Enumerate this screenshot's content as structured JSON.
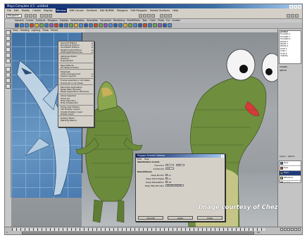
{
  "window": {
    "title": "Maya Complete 4.5 - untitled"
  },
  "menubar": {
    "items": [
      "File",
      "Edit",
      "Modify",
      "Create",
      "Display",
      "Window",
      "Edit Curves",
      "Surfaces",
      "Edit NURBS",
      "Polygons",
      "Edit Polygons",
      "Subdiv Surfaces",
      "Help"
    ],
    "selected_index": 5
  },
  "statusline": {
    "mode": "Polygons"
  },
  "shelf": {
    "tabs": [
      "General",
      "Curves",
      "Surfaces",
      "Polygons",
      "Subdivs",
      "Deformation",
      "Animation",
      "Dynamics",
      "Rendering",
      "PaintEffects",
      "Toon",
      "Cloth",
      "Fluids",
      "Fur",
      "Custom"
    ],
    "icon_colors": [
      "#2f5fb0",
      "#3a7dc9",
      "#4b8bd6",
      "#d04a2a",
      "#d8b23a",
      "#6aa84f",
      "#3a7dc9",
      "#8e5cc0",
      "#d04a2a",
      "#2f5fb0",
      "#3a7dc9",
      "#6aa84f",
      "#d8b23a",
      "#4b8bd6",
      "#2f5fb0",
      "#3a7dc9",
      "#d04a2a",
      "#6aa84f",
      "#8e5cc0",
      "#4b8bd6",
      "#2f5fb0",
      "#3a7dc9",
      "#d8b23a",
      "#6aa84f",
      "#4b8bd6",
      "#2f5fb0",
      "#d04a2a",
      "#3a7dc9",
      "#6aa84f",
      "#8e5cc0",
      "#2f5fb0",
      "#4b8bd6"
    ]
  },
  "panel_menu": [
    "View",
    "Shading",
    "Lighting",
    "Show",
    "Panels"
  ],
  "window_menu": {
    "items": [
      {
        "label": "General Editors",
        "sub": true
      },
      {
        "label": "Rendering Editors",
        "sub": true
      },
      {
        "label": "Animation Editors",
        "sub": true
      },
      {
        "label": "Relationship Editors",
        "sub": true
      },
      {
        "label": "Settings/Preferences",
        "sub": true
      },
      {
        "label": "",
        "sep": true
      },
      {
        "label": "Attribute Editor"
      },
      {
        "label": "Outliner"
      },
      {
        "label": "Hypergraph"
      },
      {
        "label": "",
        "sep": true
      },
      {
        "label": "Paint Effects"
      },
      {
        "label": "UV Texture Editor"
      },
      {
        "label": "",
        "sep": true
      },
      {
        "label": "Playblast"
      },
      {
        "label": "View Arrangement",
        "sub": true
      },
      {
        "label": "Saved Layouts",
        "sub": true
      },
      {
        "label": "",
        "sep": true
      },
      {
        "label": "Frame Selected in All Views"
      },
      {
        "label": "Frame All in All Views"
      },
      {
        "label": "",
        "sep": true
      },
      {
        "label": "Minimize Application"
      },
      {
        "label": "Raise Main Window"
      },
      {
        "label": "Raise Application Windows"
      },
      {
        "label": "",
        "sep": true
      },
      {
        "label": "Show Selected"
      },
      {
        "label": "Show All"
      },
      {
        "label": "Hide Selection"
      },
      {
        "label": "Hide Unselected"
      },
      {
        "label": "",
        "sep": true
      },
      {
        "label": "Show Last Hidden"
      },
      {
        "label": "Set Display Layers"
      },
      {
        "label": "Create Display Layer"
      },
      {
        "label": "Delete Layer"
      },
      {
        "label": "",
        "sep": true
      },
      {
        "label": "Hotkey Editor"
      },
      {
        "label": "Marking Menus"
      }
    ]
  },
  "dialog": {
    "title": "Polygon Smooth Options",
    "menu": [
      "Edit",
      "Help"
    ],
    "section1": "Subdivision Levels",
    "rows1": [
      {
        "label": "Divisions",
        "values": [
          "1",
          "1.0"
        ]
      },
      {
        "label": "Continuity",
        "values": [
          "1.0"
        ]
      }
    ],
    "section2": "Smoothness",
    "rows2": [
      {
        "label": "Keep Border",
        "values": [
          "on"
        ]
      },
      {
        "label": "Keep Hard Edges",
        "values": [
          "on"
        ]
      },
      {
        "label": "Keep Tessellation",
        "values": [
          "off"
        ]
      },
      {
        "label": "Keep Map Borders",
        "values": [
          "Smooth Internal"
        ]
      }
    ],
    "buttons": [
      "Smooth",
      "Apply",
      "Close"
    ]
  },
  "watermark": "Image courtesy of Chez Eddy",
  "channel_box": {
    "object": "pCube1",
    "attrs": [
      "Translate X",
      "Translate Y",
      "Translate Z",
      "Rotate X",
      "Rotate Y",
      "Rotate Z",
      "Scale X",
      "Scale Y",
      "Scale Z",
      "Visibility"
    ],
    "shapes_label": "SHAPES",
    "inputs_label": "INPUTS"
  },
  "layer_editor": {
    "tabs": [
      "Layers",
      "Options"
    ],
    "layers": [
      {
        "name": "Body",
        "color": "#3a7dc9",
        "selected": false
      },
      {
        "name": "Eyes",
        "color": "#d04a2a",
        "selected": false
      },
      {
        "name": "Head",
        "color": "#6aa84f",
        "selected": true
      },
      {
        "name": "Reference",
        "color": "#d8b23a",
        "selected": false
      },
      {
        "name": "Layer1",
        "color": "#8e5cc0",
        "selected": false
      }
    ]
  },
  "timeline": {
    "start": "1",
    "end": "24"
  }
}
